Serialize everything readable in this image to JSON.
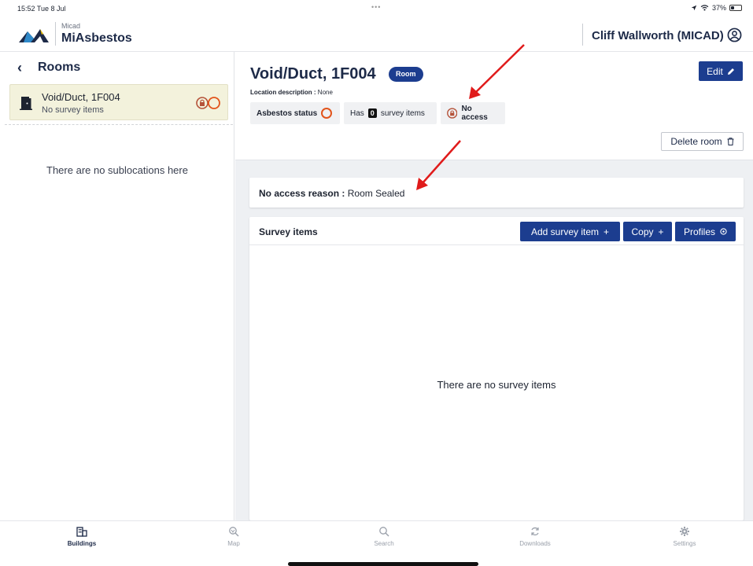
{
  "status_bar": {
    "time": "15:52  Tue 8 Jul",
    "dots": "•••",
    "battery": "37%",
    "battery_level": 0.37
  },
  "header": {
    "brand_small": "Micad",
    "brand_name": "MiAsbestos",
    "user_name": "Cliff Wallworth (MICAD)",
    "logo_icon": "mountain-logo",
    "user_icon": "user-circle-icon"
  },
  "sidebar": {
    "back_label": "Rooms",
    "rooms": [
      {
        "name": "Void/Duct, 1F004",
        "subtitle": "No survey items",
        "icon": "door-icon",
        "status_icon": "no-access-lock-icon"
      }
    ],
    "empty_text": "There are no sublocations here"
  },
  "room": {
    "title": "Void/Duct, 1F004",
    "badge": "Room",
    "edit_label": "Edit",
    "location_label": "Location description :",
    "location_value": "None",
    "asbestos_status_label": "Asbestos status",
    "survey_prefix": "Has",
    "survey_count": "0",
    "survey_suffix": "survey items",
    "no_access_label": "No access",
    "delete_label": "Delete room"
  },
  "no_access": {
    "label": "No access reason :",
    "value": "Room Sealed"
  },
  "survey_items": {
    "title": "Survey items",
    "add_label": "Add survey item",
    "copy_label": "Copy",
    "profiles_label": "Profiles",
    "empty_text": "There are no survey items"
  },
  "tabs": [
    {
      "label": "Buildings",
      "icon": "building-icon",
      "active": true
    },
    {
      "label": "Map",
      "icon": "map-search-icon",
      "active": false
    },
    {
      "label": "Search",
      "icon": "search-icon",
      "active": false
    },
    {
      "label": "Downloads",
      "icon": "sync-icon",
      "active": false
    },
    {
      "label": "Settings",
      "icon": "gear-icon",
      "active": false
    }
  ],
  "colors": {
    "primary": "#1c3d8f",
    "navy_text": "#1d2a48",
    "selected_row": "#f3f2dc",
    "asbestos_ring": "#e2541b",
    "no_access_lock": "#b5533a",
    "annotation_arrow": "#e01b1b"
  }
}
